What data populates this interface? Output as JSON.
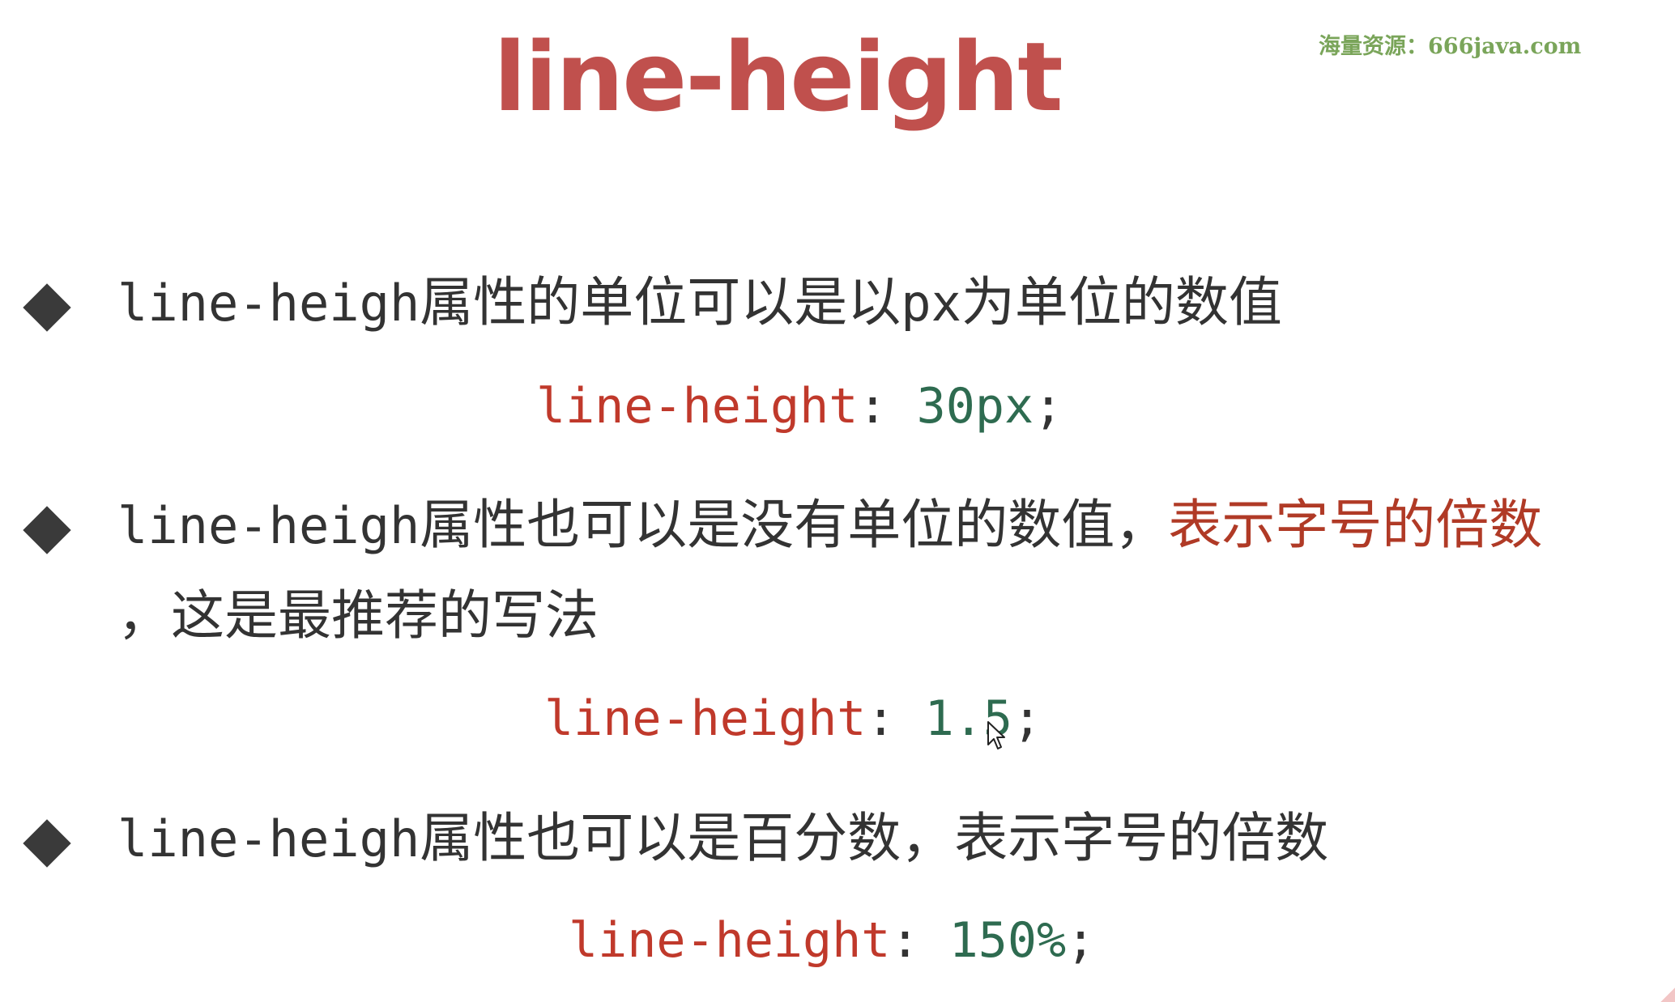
{
  "title": "line-height",
  "watermark": "海量资源：666java.com",
  "bullets": [
    {
      "mono": "line-heigh",
      "cjk": "属性的单位可以是以",
      "mono2": "px",
      "cjk2": "为单位的数值"
    },
    {
      "mono": "line-heigh",
      "cjk": "属性也可以是没有单位的数值，",
      "emph": "表示字号的倍数",
      "line2": "，这是最推荐的写法"
    },
    {
      "mono": "line-heigh",
      "cjk": "属性也可以是百分数，表示字号的倍数"
    }
  ],
  "code_examples": [
    {
      "property": "line-height",
      "colon": ": ",
      "value": "30px",
      "end": ";"
    },
    {
      "property": "line-height",
      "colon": ": ",
      "value": "1.5",
      "end": ";"
    },
    {
      "property": "line-height",
      "colon": ": ",
      "value": "150%",
      "end": ";"
    }
  ],
  "colors": {
    "title": "#c0504d",
    "emphasis": "#b03a26",
    "code_property": "#c0392b",
    "code_value": "#2e6b50",
    "body_text": "#333333",
    "watermark": "#7aa55a"
  }
}
